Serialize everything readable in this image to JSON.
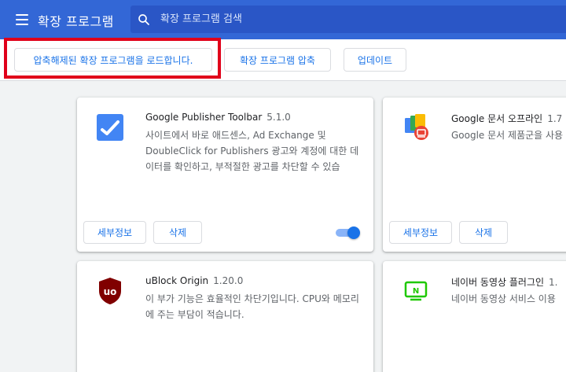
{
  "header": {
    "title": "확장 프로그램",
    "search_placeholder": "확장 프로그램 검색"
  },
  "toolbar": {
    "load_unpacked": "압축해제된 확장 프로그램을 로드합니다.",
    "pack": "확장 프로그램 압축",
    "update": "업데이트"
  },
  "extensions": [
    {
      "name": "Google Publisher Toolbar",
      "version": "5.1.0",
      "description": "사이트에서 바로 애드센스, Ad Exchange 및 DoubleClick for Publishers 광고와 계정에 대한 데이터를 확인하고, 부적절한 광고를 차단할 수 있습",
      "details": "세부정보",
      "remove": "삭제",
      "enabled": true
    },
    {
      "name": "Google 문서 오프라인",
      "version": "1.7",
      "description": "Google 문서 제품군을 사용 업을 완료할 수 있습니다.",
      "details": "세부정보",
      "remove": "삭제"
    },
    {
      "name": "uBlock Origin",
      "version": "1.20.0",
      "description": "이 부가 기능은 효율적인 차단기입니다. CPU와 메모리에 주는 부담이 적습니다."
    },
    {
      "name": "네이버 동영상 플러그인",
      "version": "1.",
      "description": "네이버 동영상 서비스 이용"
    }
  ],
  "colors": {
    "header_bg": "#3367d6",
    "accent": "#1a73e8",
    "highlight_border": "#e0001a"
  }
}
